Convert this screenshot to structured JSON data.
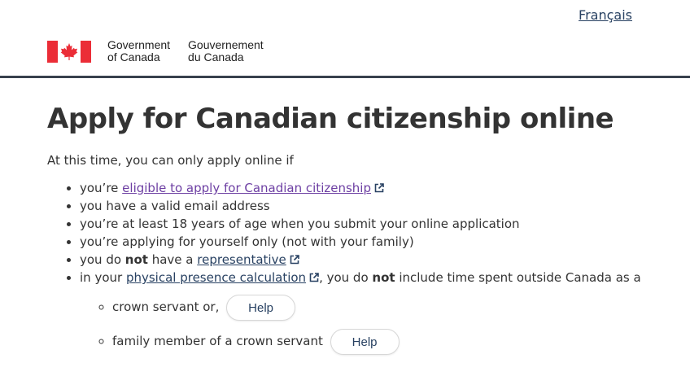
{
  "header": {
    "language_link": "Français",
    "gov_en_line1": "Government",
    "gov_en_line2": "of Canada",
    "gov_fr_line1": "Gouvernement",
    "gov_fr_line2": "du Canada"
  },
  "main": {
    "title": "Apply for Canadian citizenship online",
    "intro": "At this time, you can only apply online if",
    "items": [
      {
        "prefix": "you’re ",
        "link": "eligible to apply for Canadian citizenship"
      },
      {
        "text": "you have a valid email address"
      },
      {
        "text": "you’re at least 18 years of age when you submit your online application"
      },
      {
        "text": "you’re applying for yourself only (not with your family)"
      },
      {
        "prefix": "you do ",
        "bold": "not",
        "middle": " have a ",
        "link": "representative"
      },
      {
        "prefix": "in your ",
        "link": "physical presence calculation",
        "middle": ", you do ",
        "bold": "not",
        "suffix": " include time spent outside Canada as a"
      }
    ],
    "sub_items": [
      {
        "text": "crown servant or,",
        "button": "Help"
      },
      {
        "text": "family member of a crown servant",
        "button": "Help"
      }
    ]
  },
  "colors": {
    "flag_red": "#eb2d37",
    "visited_link": "#6d3fa3",
    "link": "#284162",
    "divider": "#38414d"
  }
}
